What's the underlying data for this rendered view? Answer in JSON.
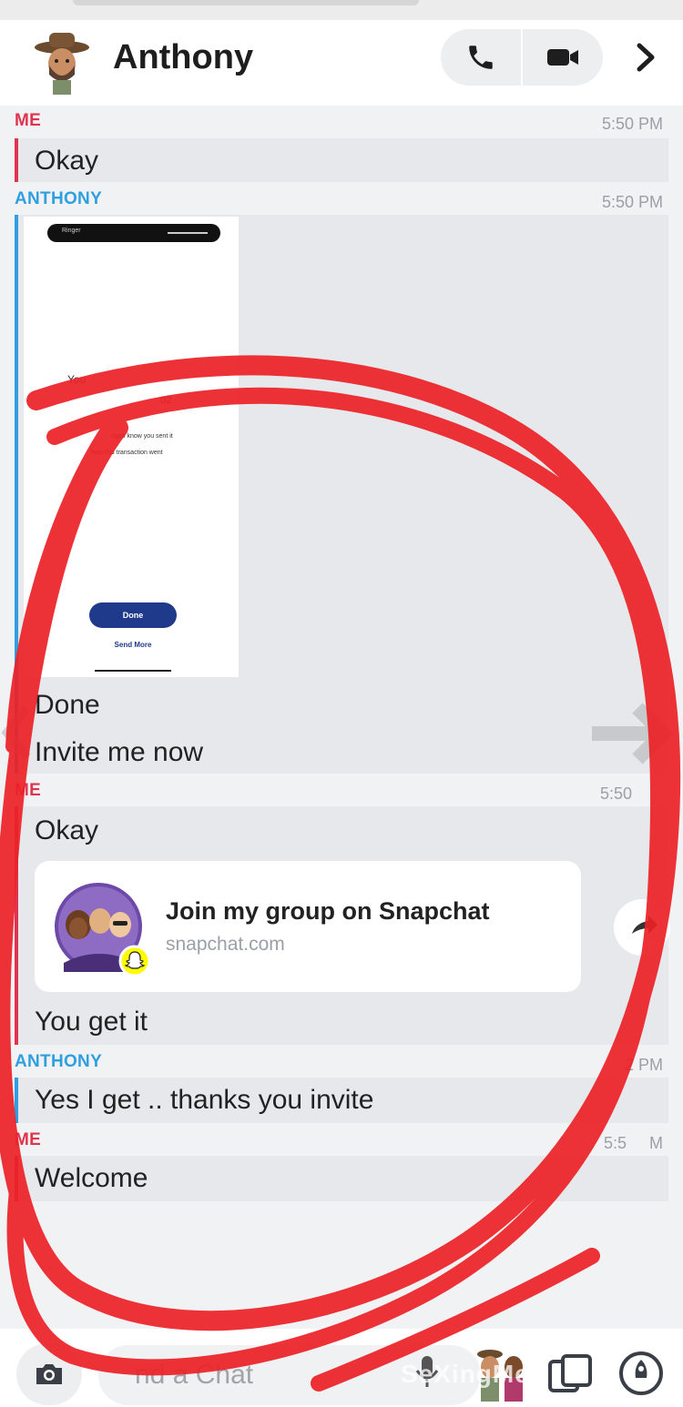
{
  "header": {
    "title": "Anthony",
    "avatar_icon": "bitmoji-avatar-icon",
    "call_icon": "phone-icon",
    "video_icon": "video-camera-icon",
    "more_icon": "chevron-right-icon"
  },
  "messages": [
    {
      "sender": "ME",
      "time": "5:50 PM",
      "lines": [
        "Okay"
      ]
    },
    {
      "sender": "ANTHONY",
      "time": "5:50 PM",
      "attachment": "screenshot",
      "lines": [
        "Done",
        "Invite me now"
      ]
    },
    {
      "sender": "ME",
      "time": "5:50",
      "lines": [
        "Okay",
        "You get it"
      ]
    },
    {
      "sender": "ANTHONY",
      "time": "2 PM",
      "lines": [
        "Yes I get .. thanks you invite"
      ]
    },
    {
      "sender": "ME",
      "time": "5:5",
      "time_tail": "M",
      "lines": [
        "Welcome"
      ]
    }
  ],
  "attachment_screenshot": {
    "notch_label": "Ringer",
    "partial_text_1": "You",
    "partial_text_2": "02",
    "partial_text_3": "ogan know you sent it",
    "partial_text_4": "how this transaction went",
    "done_button": "Done",
    "send_more": "Send More"
  },
  "link_card": {
    "title": "Join my group on Snapchat",
    "domain": "snapchat.com",
    "avatar_icon": "group-bitmoji-icon",
    "badge_icon": "snapchat-ghost-icon",
    "share_icon": "share-arrow-icon"
  },
  "composer": {
    "placeholder": "nd a Chat",
    "camera_icon": "camera-icon",
    "mic_icon": "microphone-icon",
    "bitmoji_icon": "bitmoji-sticker-icon",
    "cards_icon": "cards-icon",
    "rocket_icon": "rocket-icon"
  },
  "watermark": "SeXingMe",
  "colors": {
    "me": "#e0344e",
    "anthony": "#2f9fe0",
    "annotation": "#ec2127",
    "bubble": "#e6e8eb"
  }
}
